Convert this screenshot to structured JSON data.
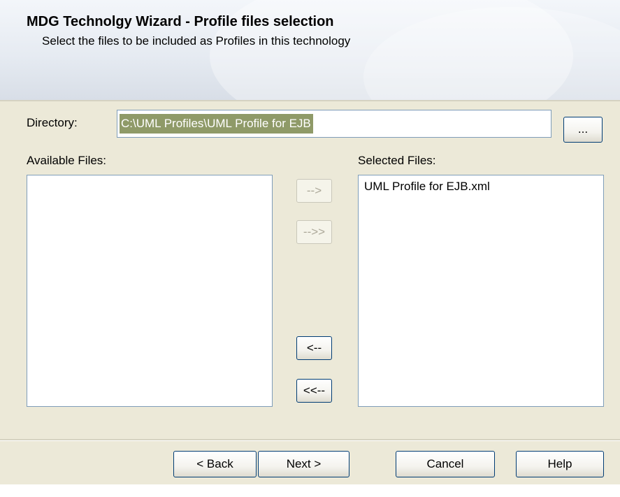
{
  "header": {
    "title": "MDG Technolgy Wizard - Profile files selection",
    "subtitle": "Select the files to be included as Profiles in this technology"
  },
  "directory": {
    "label": "Directory:",
    "value": "C:\\UML Profiles\\UML Profile for EJB",
    "browse_label": "..."
  },
  "available": {
    "label": "Available Files:",
    "items": []
  },
  "selected": {
    "label": "Selected Files:",
    "items": [
      "UML Profile for EJB.xml"
    ]
  },
  "transfer": {
    "add_label": "-->",
    "add_all_label": "-->>",
    "remove_label": "<--",
    "remove_all_label": "<<--"
  },
  "footer": {
    "back_label": "< Back",
    "next_label": "Next >",
    "cancel_label": "Cancel",
    "help_label": "Help"
  }
}
